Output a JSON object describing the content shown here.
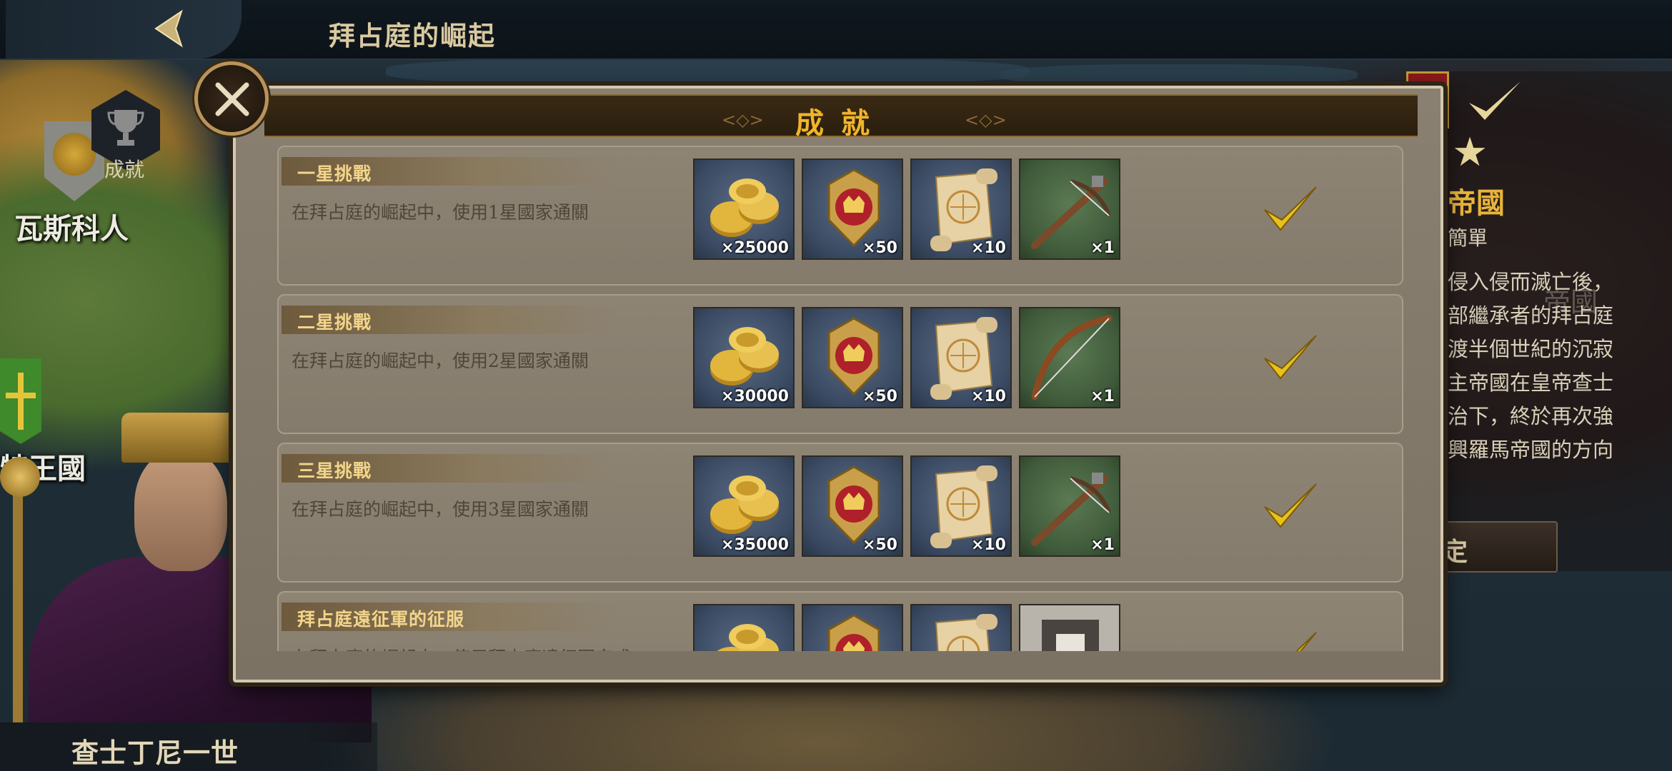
{
  "topbar": {
    "title": "拜占庭的崛起"
  },
  "left": {
    "achievement_label": "成就",
    "region_1": "瓦斯科人",
    "region_2": "特王國",
    "emperor_name": "查士丁尼一世"
  },
  "right": {
    "empire_title": "帝國",
    "difficulty": "簡單",
    "description_lines": [
      "侵入侵而滅亡後，",
      "部繼承者的拜占庭",
      "渡半個世紀的沉寂",
      "主帝國在皇帝查士",
      "治下，終於再次強",
      "興羅馬帝國的方向"
    ],
    "ghost_text": "帝國",
    "button_label": "定"
  },
  "modal": {
    "title": "成就",
    "rows": [
      {
        "title": "一星挑戰",
        "desc": "在拜占庭的崛起中，使用1星國家通關",
        "rewards": [
          {
            "icon": "gold-coins-icon",
            "count": "×25000",
            "bg": "blue"
          },
          {
            "icon": "medal-icon",
            "count": "×50",
            "bg": "blue"
          },
          {
            "icon": "scroll-icon",
            "count": "×10",
            "bg": "blue"
          },
          {
            "icon": "crossbow-icon",
            "count": "×1",
            "bg": "green"
          }
        ],
        "completed": true
      },
      {
        "title": "二星挑戰",
        "desc": "在拜占庭的崛起中，使用2星國家通關",
        "rewards": [
          {
            "icon": "gold-coins-icon",
            "count": "×30000",
            "bg": "blue"
          },
          {
            "icon": "medal-icon",
            "count": "×50",
            "bg": "blue"
          },
          {
            "icon": "scroll-icon",
            "count": "×10",
            "bg": "blue"
          },
          {
            "icon": "bow-icon",
            "count": "×1",
            "bg": "green"
          }
        ],
        "completed": true
      },
      {
        "title": "三星挑戰",
        "desc": "在拜占庭的崛起中，使用3星國家通關",
        "rewards": [
          {
            "icon": "gold-coins-icon",
            "count": "×35000",
            "bg": "blue"
          },
          {
            "icon": "medal-icon",
            "count": "×50",
            "bg": "blue"
          },
          {
            "icon": "scroll-icon",
            "count": "×10",
            "bg": "blue"
          },
          {
            "icon": "crossbow-icon",
            "count": "×1",
            "bg": "green"
          }
        ],
        "completed": true
      },
      {
        "title": "拜占庭遠征軍的征服",
        "desc": "在拜占庭的崛起中，使用拜占庭遠征軍完成",
        "rewards": [
          {
            "icon": "gold-coins-icon",
            "count": "",
            "bg": "blue"
          },
          {
            "icon": "medal-icon",
            "count": "",
            "bg": "blue"
          },
          {
            "icon": "scroll-icon",
            "count": "",
            "bg": "blue"
          },
          {
            "icon": "general-card-icon",
            "count": "",
            "bg": "gray"
          }
        ],
        "completed": true
      }
    ]
  },
  "colors": {
    "title_gold": "#f0b52a",
    "row_title": "#f3d58a",
    "check_gold": "#e8c11a"
  }
}
